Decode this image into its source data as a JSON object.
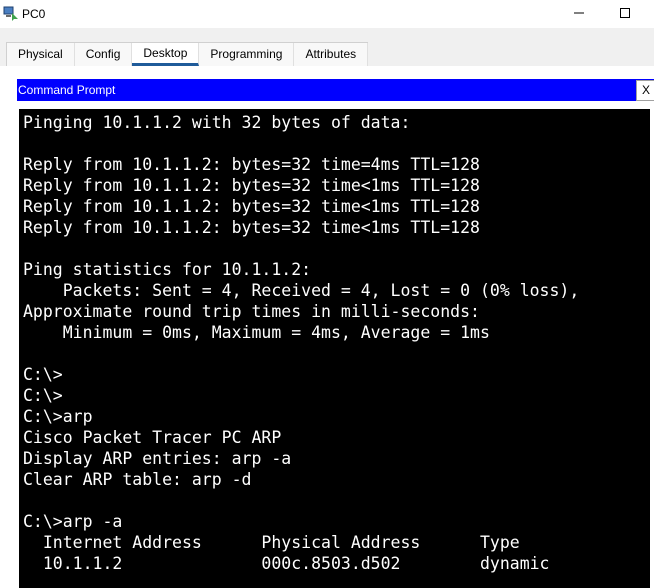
{
  "window": {
    "title": "PC0"
  },
  "tabs": [
    {
      "label": "Physical",
      "active": false
    },
    {
      "label": "Config",
      "active": false
    },
    {
      "label": "Desktop",
      "active": true
    },
    {
      "label": "Programming",
      "active": false
    },
    {
      "label": "Attributes",
      "active": false
    }
  ],
  "command_prompt": {
    "title": "Command Prompt",
    "close_label": "X"
  },
  "terminal": {
    "lines": [
      "Pinging 10.1.1.2 with 32 bytes of data:",
      "",
      "Reply from 10.1.1.2: bytes=32 time=4ms TTL=128",
      "Reply from 10.1.1.2: bytes=32 time<1ms TTL=128",
      "Reply from 10.1.1.2: bytes=32 time<1ms TTL=128",
      "Reply from 10.1.1.2: bytes=32 time<1ms TTL=128",
      "",
      "Ping statistics for 10.1.1.2:",
      "    Packets: Sent = 4, Received = 4, Lost = 0 (0% loss),",
      "Approximate round trip times in milli-seconds:",
      "    Minimum = 0ms, Maximum = 4ms, Average = 1ms",
      "",
      "C:\\>",
      "C:\\>",
      "C:\\>arp",
      "Cisco Packet Tracer PC ARP",
      "Display ARP entries: arp -a",
      "Clear ARP table: arp -d",
      "",
      "C:\\>arp -a",
      "  Internet Address      Physical Address      Type",
      "  10.1.1.2              000c.8503.d502        dynamic"
    ]
  },
  "icons": {
    "app": "packet-tracer-pc-icon",
    "minimize": "minimize-icon",
    "maximize": "maximize-icon"
  },
  "colors": {
    "cmd_header": "#0000ff",
    "terminal_bg": "#000000",
    "terminal_fg": "#ffffff",
    "active_tab_underline": "#1f5b9a"
  }
}
